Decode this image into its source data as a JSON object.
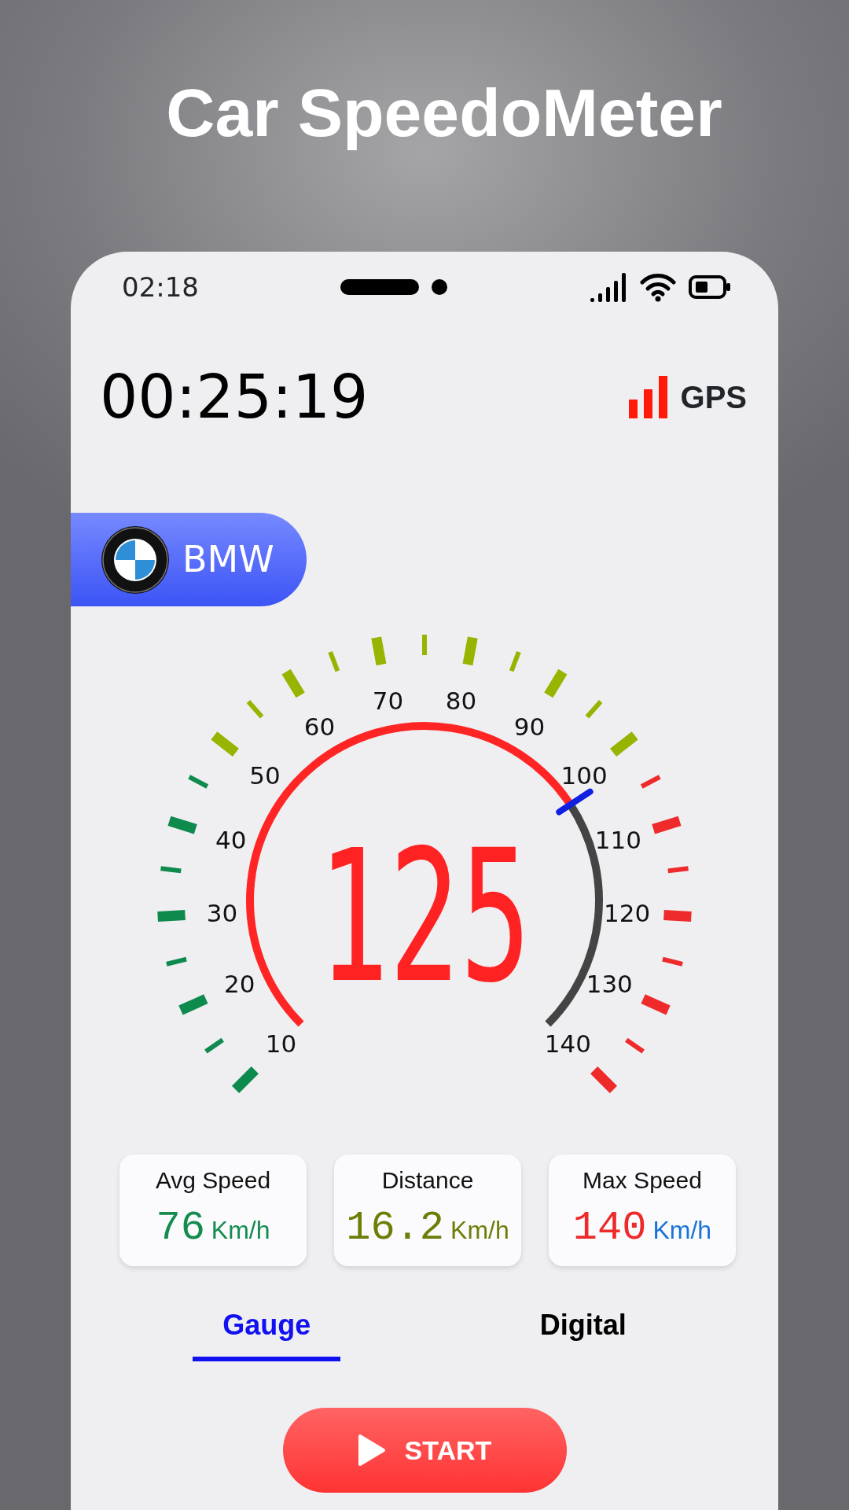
{
  "title": "Car SpeedoMeter",
  "status_bar": {
    "time": "02:18"
  },
  "timer": "00:25:19",
  "gps": {
    "label": "GPS"
  },
  "car": {
    "brand": "BMW"
  },
  "gauge": {
    "level": 0.71,
    "reading": "125",
    "ticks": [
      {
        "kind": "major",
        "label": "10",
        "color": "#0e8a4c"
      },
      {
        "kind": "minor",
        "color": "#0e8a4c"
      },
      {
        "kind": "major",
        "label": "20",
        "color": "#0e8a4c"
      },
      {
        "kind": "minor",
        "color": "#0e8a4c"
      },
      {
        "kind": "major",
        "label": "30",
        "color": "#0e8a4c"
      },
      {
        "kind": "minor",
        "color": "#0e8a4c"
      },
      {
        "kind": "major",
        "label": "40",
        "color": "#0e8a4c"
      },
      {
        "kind": "minor",
        "color": "#0e8a4c"
      },
      {
        "kind": "major",
        "label": "50",
        "color": "#96b400"
      },
      {
        "kind": "minor",
        "color": "#96b400"
      },
      {
        "kind": "major",
        "label": "60",
        "color": "#96b400"
      },
      {
        "kind": "minor",
        "color": "#96b400"
      },
      {
        "kind": "major",
        "label": "70",
        "color": "#96b400"
      },
      {
        "kind": "minor",
        "color": "#96b400"
      },
      {
        "kind": "major",
        "label": "80",
        "color": "#96b400"
      },
      {
        "kind": "minor",
        "color": "#96b400"
      },
      {
        "kind": "major",
        "label": "90",
        "color": "#96b400"
      },
      {
        "kind": "minor",
        "color": "#96b400"
      },
      {
        "kind": "major",
        "label": "100",
        "color": "#96b400"
      },
      {
        "kind": "minor",
        "color": "#ee2a2a"
      },
      {
        "kind": "major",
        "label": "110",
        "color": "#ee2a2a"
      },
      {
        "kind": "minor",
        "color": "#ee2a2a"
      },
      {
        "kind": "major",
        "label": "120",
        "color": "#ee2a2a"
      },
      {
        "kind": "minor",
        "color": "#ee2a2a"
      },
      {
        "kind": "major",
        "label": "130",
        "color": "#ee2a2a"
      },
      {
        "kind": "minor",
        "color": "#ee2a2a"
      },
      {
        "kind": "major",
        "label": "140",
        "color": "#ee2a2a"
      }
    ]
  },
  "stats": [
    {
      "label": "Avg Speed",
      "value": {
        "text": "76",
        "color": "#148c4e"
      },
      "unit": {
        "text": "Km/h",
        "color": "#148c4e"
      }
    },
    {
      "label": "Distance",
      "value": {
        "text": "16.2",
        "color": "#6f7d07"
      },
      "unit": {
        "text": "Km/h",
        "color": "#6f7d07"
      }
    },
    {
      "label": "Max Speed",
      "value": {
        "text": "140",
        "color": "#ee2a2a"
      },
      "unit": {
        "text": "Km/h",
        "color": "#1a73d9"
      }
    }
  ],
  "tabs": [
    {
      "label": "Gauge",
      "selected": true
    },
    {
      "label": "Digital",
      "selected": false
    }
  ],
  "start_button": {
    "label": "START"
  }
}
